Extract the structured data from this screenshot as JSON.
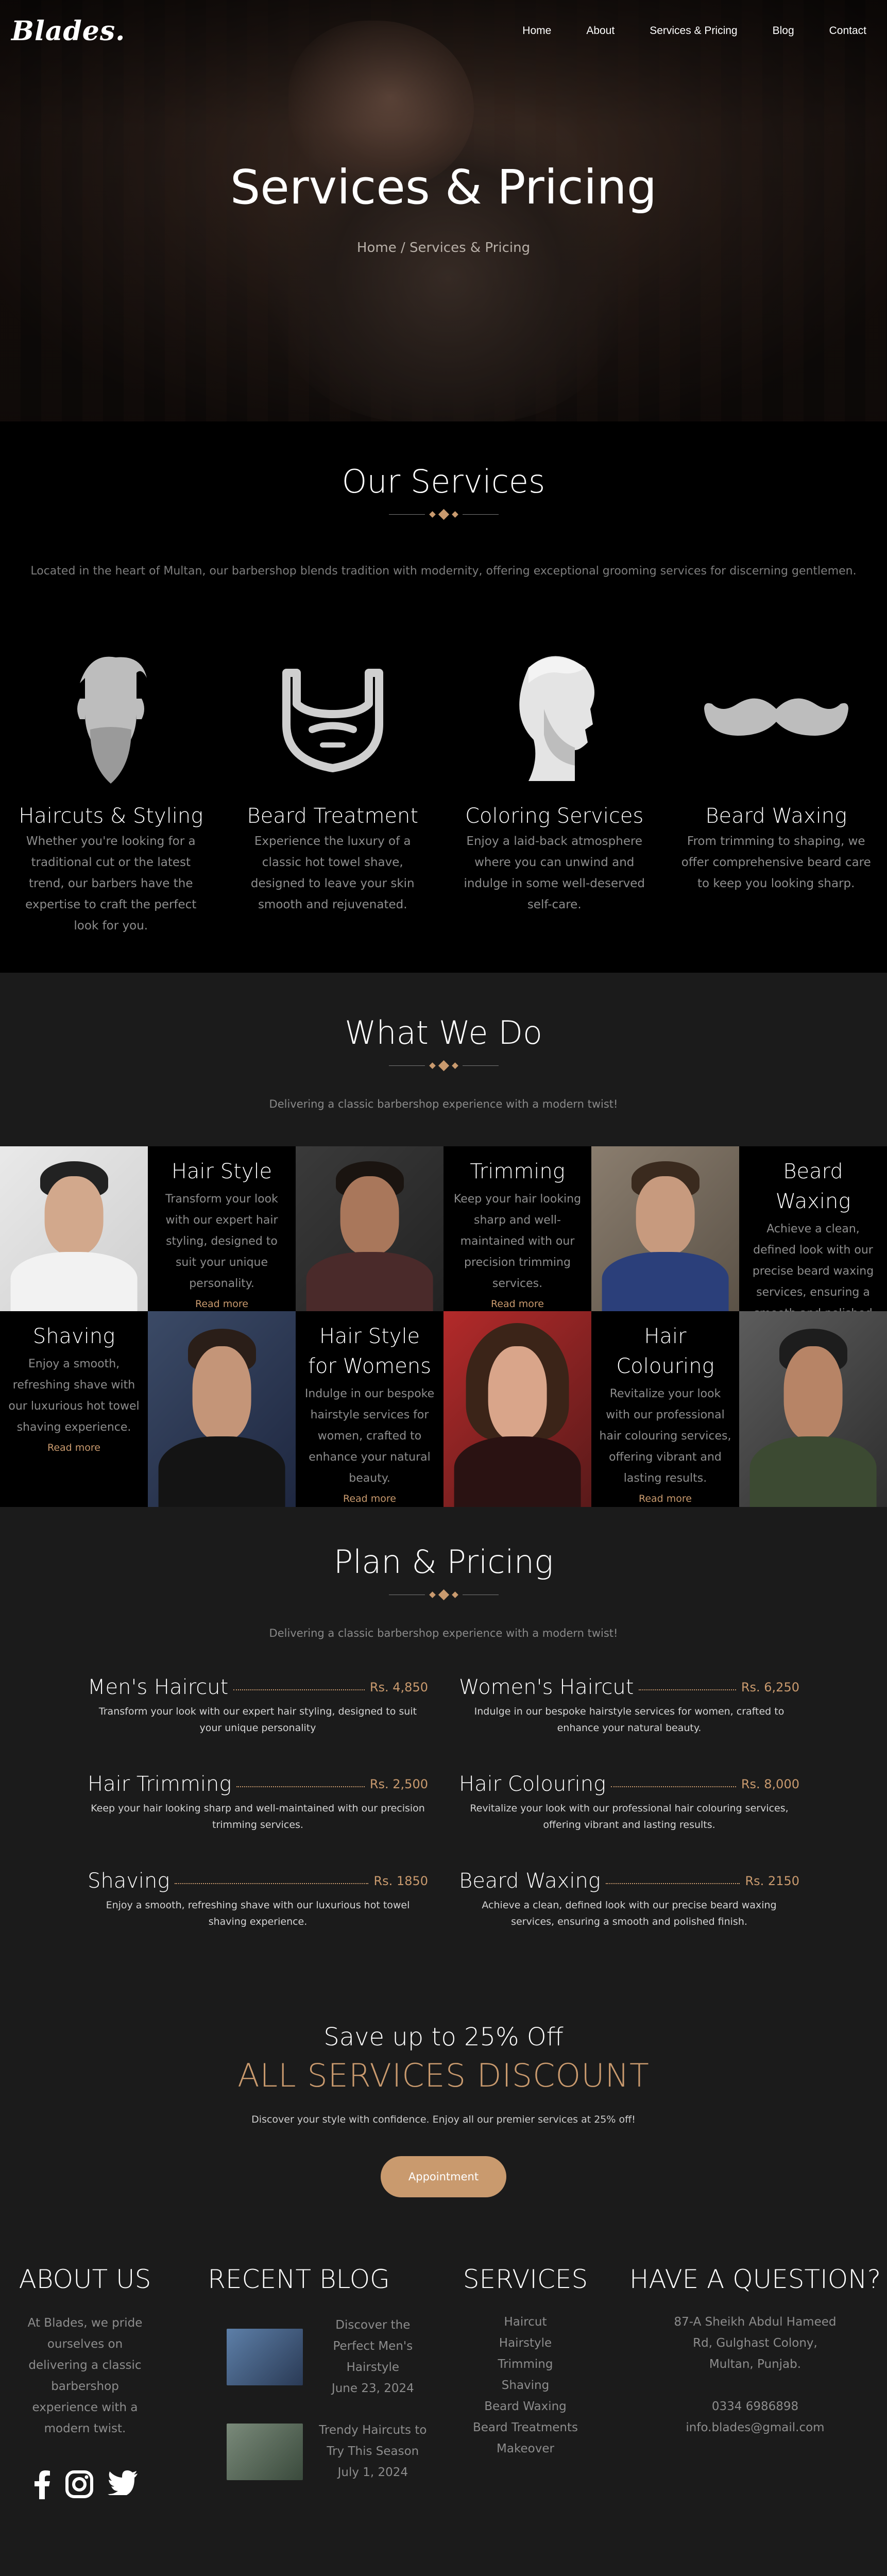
{
  "nav": {
    "logo": "Blades.",
    "links": [
      "Home",
      "About",
      "Services & Pricing",
      "Blog",
      "Contact"
    ]
  },
  "hero": {
    "title": "Services & Pricing",
    "breadcrumb": "Home / Services & Pricing"
  },
  "services": {
    "title": "Our Services",
    "lead": "Located in the heart of Multan, our barbershop blends tradition with modernity, offering exceptional grooming services for discerning gentlemen.",
    "items": [
      {
        "icon": "beard-face-icon",
        "title": "Haircuts & Styling",
        "text": "Whether you're looking for a traditional cut or the latest trend, our barbers have the expertise to craft the perfect look for you."
      },
      {
        "icon": "beard-outline-icon",
        "title": "Beard Treatment",
        "text": "Experience the luxury of a classic hot towel shave, designed to leave your skin smooth and rejuvenated."
      },
      {
        "icon": "profile-head-icon",
        "title": "Coloring Services",
        "text": "Enjoy a laid-back atmosphere where you can unwind and indulge in some well-deserved self-care."
      },
      {
        "icon": "mustache-icon",
        "title": "Beard Waxing",
        "text": "From trimming to shaping, we offer comprehensive beard care to keep you looking sharp."
      }
    ]
  },
  "whatwedo": {
    "title": "What We Do",
    "subtitle": "Delivering a classic barbershop experience with a modern twist!",
    "read_more": "Read more",
    "row1": [
      {
        "title": "Hair Style",
        "text": "Transform your look with our expert hair styling, designed to suit your unique personality."
      },
      {
        "title": "Trimming",
        "text": "Keep your hair looking sharp and well-maintained with our precision trimming services."
      },
      {
        "title": "Beard Waxing",
        "text": "Achieve a clean, defined look with our precise beard waxing services, ensuring a smooth and polished finish."
      }
    ],
    "row2": [
      {
        "title": "Shaving",
        "text": "Enjoy a smooth, refreshing shave with our luxurious hot towel shaving experience."
      },
      {
        "title": "Hair Style for Womens",
        "text": "Indulge in our bespoke hairstyle services for women, crafted to enhance your natural beauty."
      },
      {
        "title": "Hair Colouring",
        "text": "Revitalize your look with our professional hair colouring services, offering vibrant and lasting results."
      }
    ]
  },
  "pricing": {
    "title": "Plan & Pricing",
    "subtitle": "Delivering a classic barbershop experience with a modern twist!",
    "plans": [
      {
        "name": "Men's Haircut",
        "price": "Rs. 4,850",
        "text": "Transform your look with our expert hair styling, designed to suit your unique personality"
      },
      {
        "name": "Women's Haircut",
        "price": "Rs. 6,250",
        "text": "Indulge in our bespoke hairstyle services for women, crafted to enhance your natural beauty."
      },
      {
        "name": "Hair Trimming",
        "price": "Rs. 2,500",
        "text": "Keep your hair looking sharp and well-maintained with our precision trimming services."
      },
      {
        "name": "Hair Colouring",
        "price": "Rs. 8,000",
        "text": "Revitalize your look with our professional hair colouring services, offering vibrant and lasting results."
      },
      {
        "name": "Shaving",
        "price": "Rs. 1850",
        "text": "Enjoy a smooth, refreshing shave with our luxurious hot towel shaving experience."
      },
      {
        "name": "Beard Waxing",
        "price": "Rs. 2150",
        "text": "Achieve a clean, defined look with our precise beard waxing services, ensuring a smooth and polished finish."
      }
    ]
  },
  "discount": {
    "line1": "Save up to 25% Off",
    "line2": "ALL SERVICES DISCOUNT",
    "line3": "Discover your style with confidence. Enjoy all our premier services at 25% off!",
    "button": "Appointment"
  },
  "footer": {
    "about": {
      "title": "ABOUT US",
      "text": "At Blades, we pride ourselves on delivering a classic barbershop experience with a modern twist."
    },
    "blog": {
      "title": "RECENT BLOG",
      "posts": [
        {
          "title": "Discover the Perfect Men's Hairstyle",
          "date": "June 23, 2024"
        },
        {
          "title": "Trendy Haircuts to Try This Season",
          "date": "July 1, 2024"
        }
      ]
    },
    "services": {
      "title": "SERVICES",
      "items": [
        "Haircut",
        "Hairstyle",
        "Trimming",
        "Shaving",
        "Beard Waxing",
        "Beard Treatments",
        "Makeover"
      ]
    },
    "contact": {
      "title": "HAVE A QUESTION?",
      "address": "87-A Sheikh Abdul Hameed Rd, Gulghast Colony, Multan, Punjab.",
      "phone": "0334 6986898",
      "email": "info.blades@gmail.com"
    }
  },
  "colors": {
    "accent": "#c99a6e",
    "dark": "#000000",
    "panel": "#1b1b1b",
    "muted": "#8d8d8d"
  }
}
